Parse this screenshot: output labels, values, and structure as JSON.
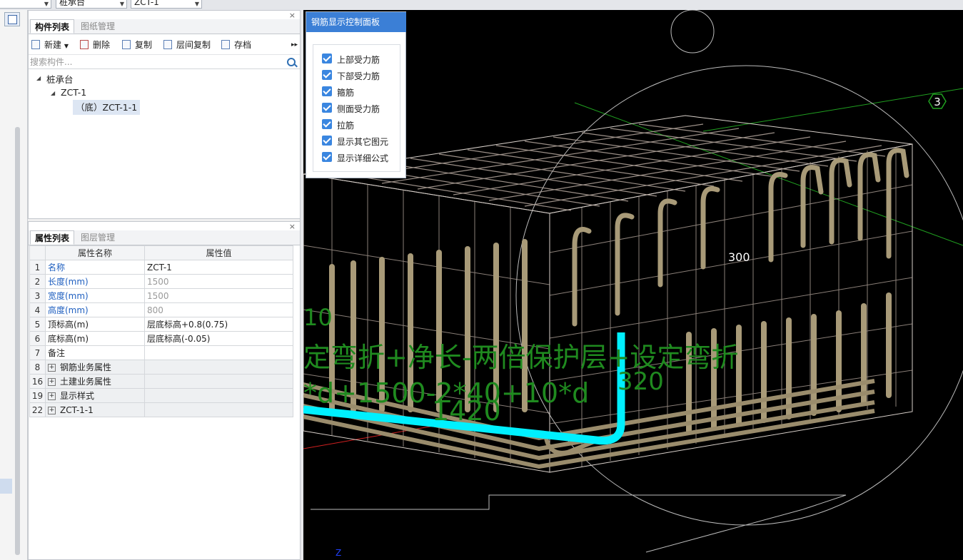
{
  "topbar": {
    "combo1": "",
    "combo2": "桩承台",
    "combo3": "ZCT-1"
  },
  "component_panel": {
    "tabs": [
      "构件列表",
      "图纸管理"
    ],
    "toolbar": {
      "new": "新建",
      "delete": "删除",
      "copy": "复制",
      "floor_copy": "层间复制",
      "archive": "存档",
      "more": "▸▸"
    },
    "search_placeholder": "搜索构件...",
    "tree": {
      "root": "桩承台",
      "child": "ZCT-1",
      "leaf": "（底）ZCT-1-1"
    }
  },
  "property_panel": {
    "tabs": [
      "属性列表",
      "图层管理"
    ],
    "headers": {
      "name": "属性名称",
      "value": "属性值"
    },
    "rows": [
      {
        "num": "1",
        "name": "名称",
        "value": "ZCT-1"
      },
      {
        "num": "2",
        "name": "长度(mm)",
        "value": "1500"
      },
      {
        "num": "3",
        "name": "宽度(mm)",
        "value": "1500"
      },
      {
        "num": "4",
        "name": "高度(mm)",
        "value": "800"
      },
      {
        "num": "5",
        "name": "顶标高(m)",
        "value": "层底标高+0.8(0.75)"
      },
      {
        "num": "6",
        "name": "底标高(m)",
        "value": "层底标高(-0.05)"
      },
      {
        "num": "7",
        "name": "备注",
        "value": ""
      },
      {
        "num": "8",
        "name": "钢筋业务属性",
        "value": ""
      },
      {
        "num": "16",
        "name": "土建业务属性",
        "value": ""
      },
      {
        "num": "19",
        "name": "显示样式",
        "value": ""
      },
      {
        "num": "22",
        "name": "ZCT-1-1",
        "value": ""
      }
    ]
  },
  "control_panel": {
    "title": "钢筋显示控制面板",
    "items": [
      "上部受力筋",
      "下部受力筋",
      "箍筋",
      "侧面受力筋",
      "拉筋",
      "显示其它图元",
      "显示详细公式"
    ],
    "checked": [
      true,
      true,
      true,
      true,
      true,
      true,
      true
    ]
  },
  "viewport": {
    "axis_label": "3",
    "dim_300": "300",
    "formula_line1": "定弯折+净长-两倍保护层+设定弯折",
    "formula_line2": "*d+1500-2*40+10*d",
    "text_1420": "1420",
    "text_320": "320",
    "text_10": "10",
    "axis_z": "Z",
    "colors": {
      "highlight": "#00f0ff",
      "formula": "#1f8a1f",
      "rebar": "#b8a88a",
      "cage": "#c9b9ad"
    }
  }
}
